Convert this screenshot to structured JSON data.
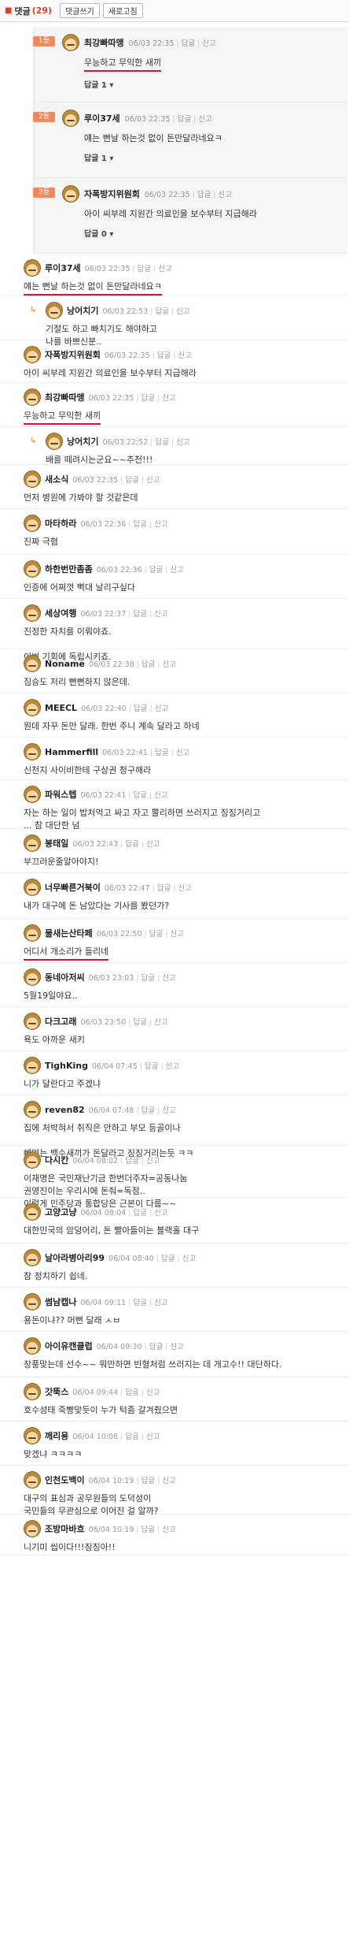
{
  "topbar": {
    "icon": "comment-icon",
    "title": "댓글",
    "count": "(29)",
    "write_label": "댓글쓰기",
    "refresh_label": "새로고침"
  },
  "best": [
    {
      "badge": "1등",
      "nick": "최강빠따맹",
      "time": "06/03 22:35",
      "reply": "답글",
      "report": "신고",
      "text": "무능하고 무익한 새끼",
      "replies": "답글 1 ▾"
    },
    {
      "badge": "2등",
      "nick": "루이37세",
      "time": "06/03 22:35",
      "reply": "답글",
      "report": "신고",
      "text": "얘는 뻔날 하는것 없이 돈만달라네요ㅋ",
      "replies": "답글 1 ▾"
    },
    {
      "badge": "3등",
      "nick": "자폭방지위원회",
      "time": "06/03 22:35",
      "reply": "답글",
      "report": "신고",
      "text": "아이 씨부레 지원간 의료인을 보수부터 지급해라",
      "replies": "답글 0 ▾"
    }
  ],
  "comments": [
    {
      "nick": "루이37세",
      "time": "06/03 22:35",
      "reply": "답글",
      "report": "신고",
      "lines": [
        "얘는 뻔날 하는것 없이 돈만달라네요ㅋ"
      ],
      "nested": false
    },
    {
      "nick": "낭어치기",
      "time": "06/03 22:53",
      "reply": "답글",
      "report": "신고",
      "lines": [
        "기절도 하고 빠치기도 해야하고",
        "나를 바쁘신분.."
      ],
      "nested": true
    },
    {
      "nick": "자폭방지위원회",
      "time": "06/03 22:35",
      "reply": "답글",
      "report": "신고",
      "lines": [
        "아이 씨부레 지원간 의료인을 보수부터 지급해라"
      ],
      "nested": false
    },
    {
      "nick": "최강빠따맹",
      "time": "06/03 22:35",
      "reply": "답글",
      "report": "신고",
      "lines": [
        "무능하고 무익한 새끼"
      ],
      "nested": false
    },
    {
      "nick": "낭어치기",
      "time": "06/03 22:52",
      "reply": "답글",
      "report": "신고",
      "lines": [
        "배를 떼려시는군요~~추천!!!"
      ],
      "nested": true
    },
    {
      "nick": "새소식",
      "time": "06/03 22:35",
      "reply": "답글",
      "report": "신고",
      "lines": [
        "먼저 병원에 가봐야 할 것같은데"
      ],
      "nested": false
    },
    {
      "nick": "마타하라",
      "time": "06/03 22:36",
      "reply": "답글",
      "report": "신고",
      "lines": [
        "진짜 극혐"
      ],
      "nested": false
    },
    {
      "nick": "하한번만좀좀",
      "time": "06/03 22:36",
      "reply": "답글",
      "report": "신고",
      "lines": [
        "인증에 어쩌껏 뻑대 날리구싶다"
      ],
      "nested": false
    },
    {
      "nick": "세상여행",
      "time": "06/03 22:37",
      "reply": "답글",
      "report": "신고",
      "lines": [
        "진정한 자치를 이뤄야죠.",
        "",
        "이번 기회에 독립시키죠."
      ],
      "nested": false
    },
    {
      "nick": "Noname",
      "time": "06/03 22:38",
      "reply": "답글",
      "report": "신고",
      "lines": [
        "짐승도 저리 뻔뻔하지 않은데."
      ],
      "nested": false
    },
    {
      "nick": "MEECL",
      "time": "06/03 22:40",
      "reply": "답글",
      "report": "신고",
      "lines": [
        "뭔데 자꾸 돈만 달래. 한번 주니 계속 달라고 하네"
      ],
      "nested": false
    },
    {
      "nick": "Hammerfill",
      "time": "06/03 22:41",
      "reply": "답글",
      "report": "신고",
      "lines": [
        "신천지 사이비한테 구상권 청구해라"
      ],
      "nested": false
    },
    {
      "nick": "파워스텝",
      "time": "06/03 22:41",
      "reply": "답글",
      "report": "신고",
      "lines": [
        "자는 하는 일이 밥처먹고 싸고 자고 뿔리하면 쓰러지고 징징거리고",
        "... 참 대단한 넘"
      ],
      "nested": false
    },
    {
      "nick": "봉태일",
      "time": "06/03 22:43",
      "reply": "답글",
      "report": "신고",
      "lines": [
        "부끄러운줄알아야지!"
      ],
      "nested": false
    },
    {
      "nick": "너무빠른거북이",
      "time": "06/03 22:47",
      "reply": "답글",
      "report": "신고",
      "lines": [
        "내가 대구에 돈 남았다는 기사를 봤던가?"
      ],
      "nested": false
    },
    {
      "nick": "물새는산타페",
      "time": "06/03 22:50",
      "reply": "답글",
      "report": "신고",
      "lines": [
        "어디서 개소리가 들리네"
      ],
      "nested": false
    },
    {
      "nick": "동네아저씨",
      "time": "06/03 23:03",
      "reply": "답글",
      "report": "신고",
      "lines": [
        "5월19일야요.."
      ],
      "nested": false
    },
    {
      "nick": "다크고래",
      "time": "06/03 23:50",
      "reply": "답글",
      "report": "신고",
      "lines": [
        "욕도 아까운 새키"
      ],
      "nested": false
    },
    {
      "nick": "TighKing",
      "time": "06/04 07:45",
      "reply": "답글",
      "report": "신고",
      "lines": [
        "니가 달란다고 주겠냐"
      ],
      "nested": false
    },
    {
      "nick": "reven82",
      "time": "06/04 07:48",
      "reply": "답글",
      "report": "신고",
      "lines": [
        "집에 처박혀서 취직은 안하고 부모 등골이나",
        "",
        "빼먹는 백수새끼가 돈달라고 징징거리는듯 ㅋㅋ"
      ],
      "nested": false
    },
    {
      "nick": "다시칸",
      "time": "06/04 08:02",
      "reply": "답글",
      "report": "신고",
      "lines": [
        "이재명은 국민재난기금 한번더주자=공동나눔",
        "권영진이는 우리시에 돈줘=독점..",
        "이렇게 민주당과 통합당은 근본이 다름~~"
      ],
      "nested": false
    },
    {
      "nick": "고양고냥",
      "time": "06/04 08:04",
      "reply": "답글",
      "report": "신고",
      "lines": [
        "대한민국의 암덩어리, 돈 빨아들이는 블랙홀 대구"
      ],
      "nested": false
    },
    {
      "nick": "날아라병아리99",
      "time": "06/04 08:40",
      "reply": "답글",
      "report": "신고",
      "lines": [
        "참 정치하기 쉽네."
      ],
      "nested": false
    },
    {
      "nick": "썸남캡나",
      "time": "06/04 09:11",
      "reply": "답글",
      "report": "신고",
      "lines": [
        "용돈이냐?? 머뻔 달래 ㅅㅂ"
      ],
      "nested": false
    },
    {
      "nick": "아이유캔클럽",
      "time": "06/04 09:30",
      "reply": "답글",
      "report": "신고",
      "lines": [
        "장풍맞는데 선수~~ 뭐만하면 빈혈처럼 쓰러지는 데 개고수!! 대단하다."
      ],
      "nested": false
    },
    {
      "nick": "갓뚝스",
      "time": "06/04 09:44",
      "reply": "답글",
      "report": "신고",
      "lines": [
        "호수성태 죽빵맞듯이 누가 턱좀 갈겨줬으면"
      ],
      "nested": false
    },
    {
      "nick": "깨리용",
      "time": "06/04 10:06",
      "reply": "답글",
      "report": "신고",
      "lines": [
        "맞겠냐 ㅋㅋㅋㅋ"
      ],
      "nested": false
    },
    {
      "nick": "인천도백이",
      "time": "06/04 10:19",
      "reply": "답글",
      "report": "신고",
      "lines": [
        "대구의 표심과 공무원들의 도덕성이",
        "국민들의 무관심으로 이어진 걸 알까?"
      ],
      "nested": false
    },
    {
      "nick": "조방마바흐",
      "time": "06/04 10:19",
      "reply": "답글",
      "report": "신고",
      "lines": [
        "니기미 씹이다!!!징징아!!"
      ],
      "nested": false
    }
  ],
  "colors": {
    "accent": "#d9411e",
    "underline": "#e0102f",
    "badge": "#f08a5d"
  }
}
